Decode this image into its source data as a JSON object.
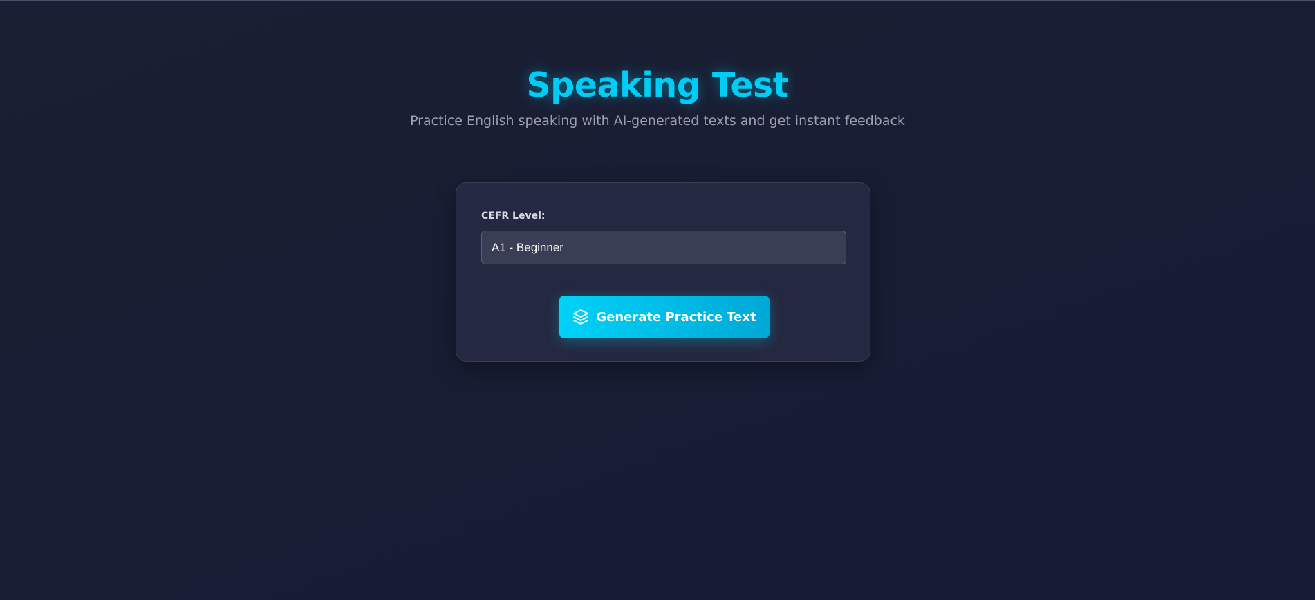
{
  "header": {
    "title": "Speaking Test",
    "subtitle": "Practice English speaking with AI-generated texts and get instant feedback"
  },
  "form": {
    "level_label": "CEFR Level:",
    "level_selected": "A1 - Beginner",
    "generate_button_label": "Generate Practice Text",
    "generate_button_icon": "layers-icon"
  },
  "colors": {
    "accent": "#00cdf5",
    "background": "#1a1f33",
    "card": "#242840",
    "subtitle_text": "#9aa0ae"
  }
}
